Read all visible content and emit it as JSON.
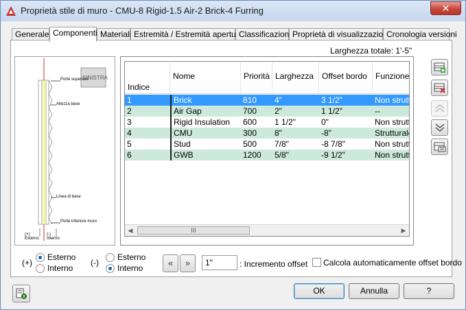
{
  "window": {
    "title": "Proprietà stile di muro - CMU-8 Rigid-1.5 Air-2 Brick-4 Furring",
    "close_label": "✕",
    "icon": "autocad-a-icon"
  },
  "tabs": [
    {
      "label": "Generale",
      "active": false
    },
    {
      "label": "Componenti",
      "active": true
    },
    {
      "label": "Materiali",
      "active": false
    },
    {
      "label": "Estremità / Estremità apertura",
      "active": false
    },
    {
      "label": "Classificazioni",
      "active": false
    },
    {
      "label": "Proprietà di visualizzazione",
      "active": false
    },
    {
      "label": "Cronologia versioni",
      "active": false
    }
  ],
  "total_width": "Larghezza totale: 1'-5\"",
  "preview": {
    "badge": "SINISTRA",
    "labels": {
      "top": "Porte superiore",
      "height": "Altezza base",
      "base_line": "Linea di base",
      "bottom": "Porte inferiore muro",
      "exterior": "(+)\nEsterno",
      "interior": "(-)\nInterno"
    }
  },
  "grid": {
    "columns": [
      "Indice",
      "Nome",
      "Priorità",
      "Larghezza",
      "Offset bordo",
      "Funzione"
    ],
    "rows": [
      {
        "index": "1",
        "name": "Brick",
        "priority": "810",
        "width": "4\"",
        "offset": "3 1/2\"",
        "function": "Non strutturale",
        "selected": true
      },
      {
        "index": "2",
        "name": "Air Gap",
        "priority": "700",
        "width": "2\"",
        "offset": "1 1/2\"",
        "function": "--",
        "selected": false
      },
      {
        "index": "3",
        "name": "Rigid Insulation",
        "priority": "600",
        "width": "1 1/2\"",
        "offset": "0\"",
        "function": "Non strutturale",
        "selected": false
      },
      {
        "index": "4",
        "name": "CMU",
        "priority": "300",
        "width": "8\"",
        "offset": "-8\"",
        "function": "Strutturale",
        "selected": false
      },
      {
        "index": "5",
        "name": "Stud",
        "priority": "500",
        "width": "7/8\"",
        "offset": "-8 7/8\"",
        "function": "Non strutturale",
        "selected": false
      },
      {
        "index": "6",
        "name": "GWB",
        "priority": "1200",
        "width": "5/8\"",
        "offset": "-9 1/2\"",
        "function": "Non strutturale",
        "selected": false
      }
    ],
    "scroll_thumb": "III"
  },
  "side_buttons": [
    {
      "icon": "add-component-icon",
      "enabled": true
    },
    {
      "icon": "delete-component-icon",
      "enabled": true
    },
    {
      "icon": "move-up-icon",
      "enabled": false
    },
    {
      "icon": "move-down-icon",
      "enabled": true
    },
    {
      "icon": "component-list-icon",
      "enabled": true
    }
  ],
  "bottom": {
    "plus_label": "(+)",
    "minus_label": "(-)",
    "plus_options": [
      {
        "label": "Esterno",
        "checked": true
      },
      {
        "label": "Interno",
        "checked": false
      }
    ],
    "minus_options": [
      {
        "label": "Esterno",
        "checked": false
      },
      {
        "label": "Interno",
        "checked": true
      }
    ],
    "nav_prev": "«",
    "nav_next": "»",
    "increment_value": "1\"",
    "increment_label": ": Incremento offset",
    "auto_offset_label": "Calcola automaticamente offset bordo",
    "auto_offset_checked": false
  },
  "buttons": {
    "ok": "OK",
    "cancel": "Annulla",
    "help": "?"
  }
}
